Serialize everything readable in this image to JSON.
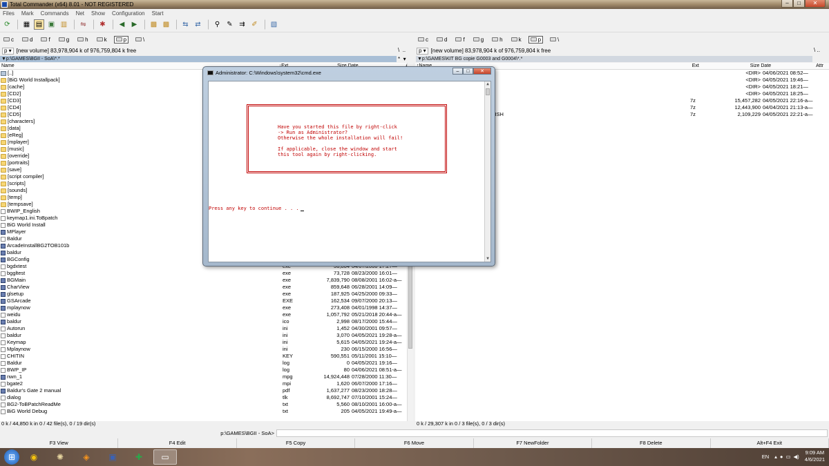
{
  "app": {
    "title": "Total Commander (x64) 8.01 - NOT REGISTERED"
  },
  "menu": [
    "Files",
    "Mark",
    "Commands",
    "Net",
    "Show",
    "Configuration",
    "Start"
  ],
  "drives": [
    "c",
    "d",
    "f",
    "g",
    "h",
    "k",
    "p",
    "\\"
  ],
  "left": {
    "volume": "[new volume]  83,978,904 k of 976,759,804 k free",
    "path": "▼p:\\GAMES\\BGII - SoA\\*.*",
    "headers": {
      "name": "Name",
      "ext": "↓Ext",
      "size": "Size",
      "date": "Date",
      "attr": "Attr"
    },
    "rows": [
      {
        "name": "[..]",
        "ext": "",
        "size": "",
        "date": "",
        "icon": "up"
      },
      {
        "name": "[BiG World Installpack]",
        "ext": "",
        "size": "",
        "date": "",
        "icon": "folder"
      },
      {
        "name": "[cache]",
        "ext": "",
        "size": "",
        "date": "",
        "icon": "folder"
      },
      {
        "name": "[CD2]",
        "ext": "",
        "size": "",
        "date": "",
        "icon": "folder"
      },
      {
        "name": "[CD3]",
        "ext": "",
        "size": "",
        "date": "",
        "icon": "folder"
      },
      {
        "name": "[CD4]",
        "ext": "",
        "size": "",
        "date": "",
        "icon": "folder"
      },
      {
        "name": "[CD5]",
        "ext": "",
        "size": "",
        "date": "",
        "icon": "folder"
      },
      {
        "name": "[characters]",
        "ext": "",
        "size": "",
        "date": "",
        "icon": "folder"
      },
      {
        "name": "[data]",
        "ext": "",
        "size": "",
        "date": "",
        "icon": "folder"
      },
      {
        "name": "[eReg]",
        "ext": "",
        "size": "",
        "date": "",
        "icon": "folder"
      },
      {
        "name": "[mplayer]",
        "ext": "",
        "size": "",
        "date": "",
        "icon": "folder"
      },
      {
        "name": "[music]",
        "ext": "",
        "size": "",
        "date": "",
        "icon": "folder"
      },
      {
        "name": "[override]",
        "ext": "",
        "size": "",
        "date": "",
        "icon": "folder"
      },
      {
        "name": "[portraits]",
        "ext": "",
        "size": "",
        "date": "",
        "icon": "folder"
      },
      {
        "name": "[save]",
        "ext": "",
        "size": "",
        "date": "",
        "icon": "folder"
      },
      {
        "name": "[script compiler]",
        "ext": "",
        "size": "",
        "date": "",
        "icon": "folder"
      },
      {
        "name": "[scripts]",
        "ext": "",
        "size": "",
        "date": "",
        "icon": "folder"
      },
      {
        "name": "[sounds]",
        "ext": "",
        "size": "",
        "date": "",
        "icon": "folder"
      },
      {
        "name": "[temp]",
        "ext": "",
        "size": "",
        "date": "",
        "icon": "folder"
      },
      {
        "name": "[tempsave]",
        "ext": "",
        "size": "",
        "date": "",
        "icon": "folder"
      },
      {
        "name": "BWIP_English",
        "ext": "",
        "size": "",
        "date": "",
        "icon": "file"
      },
      {
        "name": "keymap1.ini.ToBpatch",
        "ext": "",
        "size": "",
        "date": "",
        "icon": "file"
      },
      {
        "name": "BiG World Install",
        "ext": "",
        "size": "",
        "date": "",
        "icon": "file"
      },
      {
        "name": "MPlayer",
        "ext": "",
        "size": "",
        "date": "",
        "icon": "exe"
      },
      {
        "name": "Baldur",
        "ext": "",
        "size": "",
        "date": "",
        "icon": "file"
      },
      {
        "name": "ArcadeInstallBG2TOB101b",
        "ext": "",
        "size": "",
        "date": "",
        "icon": "exe"
      },
      {
        "name": "baldur",
        "ext": "",
        "size": "",
        "date": "",
        "icon": "exe"
      },
      {
        "name": "BGConfig",
        "ext": "",
        "size": "",
        "date": "",
        "icon": "exe"
      },
      {
        "name": "bgdxtest",
        "ext": "exe",
        "size": "36,864",
        "date": "04/07/2000 17:27—",
        "icon": "file"
      },
      {
        "name": "bggltest",
        "ext": "exe",
        "size": "73,728",
        "date": "08/23/2000 16:01—",
        "icon": "file"
      },
      {
        "name": "BGMain",
        "ext": "exe",
        "size": "7,839,790",
        "date": "08/08/2001 16:02-a—",
        "icon": "exe"
      },
      {
        "name": "CharView",
        "ext": "exe",
        "size": "859,648",
        "date": "06/28/2001 14:09—",
        "icon": "exe"
      },
      {
        "name": "glsetup",
        "ext": "exe",
        "size": "187,925",
        "date": "04/25/2000 09:33—",
        "icon": "exe"
      },
      {
        "name": "GSArcade",
        "ext": "EXE",
        "size": "162,534",
        "date": "09/07/2000 20:13—",
        "icon": "exe"
      },
      {
        "name": "mplaynow",
        "ext": "exe",
        "size": "273,408",
        "date": "04/01/1998 14:37—",
        "icon": "exe"
      },
      {
        "name": "weidu",
        "ext": "exe",
        "size": "1,057,792",
        "date": "05/21/2018 20:44-a—",
        "icon": "file"
      },
      {
        "name": "baldur",
        "ext": "ico",
        "size": "2,998",
        "date": "08/17/2000 15:44—",
        "icon": "exe"
      },
      {
        "name": "Autorun",
        "ext": "ini",
        "size": "1,452",
        "date": "04/30/2001 09:57—",
        "icon": "file"
      },
      {
        "name": "baldur",
        "ext": "ini",
        "size": "3,070",
        "date": "04/05/2021 19:28-a—",
        "icon": "file"
      },
      {
        "name": "Keymap",
        "ext": "ini",
        "size": "5,615",
        "date": "04/05/2021 19:24-a—",
        "icon": "file"
      },
      {
        "name": "Mplaynow",
        "ext": "ini",
        "size": "230",
        "date": "06/15/2000 16:56—",
        "icon": "file"
      },
      {
        "name": "CHITIN",
        "ext": "KEY",
        "size": "590,551",
        "date": "05/11/2001 15:10—",
        "icon": "file"
      },
      {
        "name": "Baldur",
        "ext": "log",
        "size": "0",
        "date": "04/05/2021 19:16—",
        "icon": "file"
      },
      {
        "name": "BWP_IP",
        "ext": "log",
        "size": "80",
        "date": "04/06/2021 08:51-a—",
        "icon": "file"
      },
      {
        "name": "nwn_1",
        "ext": "mpg",
        "size": "14,924,448",
        "date": "07/28/2000 11:30—",
        "icon": "exe"
      },
      {
        "name": "bgate2",
        "ext": "mpi",
        "size": "1,620",
        "date": "06/07/2000 17:16—",
        "icon": "file"
      },
      {
        "name": "Baldur's Gate 2 manual",
        "ext": "pdf",
        "size": "1,637,277",
        "date": "08/23/2000 18:28—",
        "icon": "exe"
      },
      {
        "name": "dialog",
        "ext": "tlk",
        "size": "8,692,747",
        "date": "07/10/2001 15:24—",
        "icon": "file"
      },
      {
        "name": "BG2-ToBPatchReadMe",
        "ext": "txt",
        "size": "5,560",
        "date": "08/10/2001 16:00-a—",
        "icon": "file"
      },
      {
        "name": "BiG World Debug",
        "ext": "txt",
        "size": "205",
        "date": "04/05/2021 19:49-a—",
        "icon": "file"
      }
    ],
    "status": "0 k / 44,850 k in 0 / 42 file(s), 0 / 19 dir(s)"
  },
  "right": {
    "volume": "[new volume]  83,978,904 k of 976,759,804 k free",
    "path": "▼p:\\GAMES\\KIT BG copie G0003 and G0004\\*.*",
    "headers": {
      "name": "↑Name",
      "ext": "Ext",
      "size": "Size",
      "date": "Date",
      "attr": "Attr"
    },
    "rows": [
      {
        "name": "",
        "ext": "",
        "size": "<DIR>",
        "date": "04/06/2021 08:52—"
      },
      {
        "name": "",
        "ext": "",
        "size": "<DIR>",
        "date": "04/05/2021 19:46—"
      },
      {
        "name": "",
        "ext": "",
        "size": "<DIR>",
        "date": "04/05/2021 18:21—"
      },
      {
        "name": "",
        "ext": "",
        "size": "<DIR>",
        "date": "04/05/2021 18:25—"
      },
      {
        "name": "",
        "ext": "7z",
        "size": "15,457,282",
        "date": "04/05/2021 22:16-a—"
      },
      {
        "name": "",
        "ext": "7z",
        "size": "12,443,900",
        "date": "04/04/2021 21:13-a—"
      },
      {
        "name": "NGLISH",
        "ext": "7z",
        "size": "2,109,229",
        "date": "04/05/2021 22:21-a—"
      }
    ],
    "status": "0 k / 29,307 k in 0 / 3 file(s), 0 / 3 dir(s)"
  },
  "cmdline": {
    "prompt": "p:\\GAMES\\BGII - SoA>"
  },
  "fkeys": [
    "F3 View",
    "F4 Edit",
    "F5 Copy",
    "F6 Move",
    "F7 NewFolder",
    "F8 Delete",
    "Alt+F4 Exit"
  ],
  "console": {
    "title": "Administrator: C:\\Windows\\system32\\cmd.exe",
    "message": "Have you started this file by right-click\n-> Run as Administrator?\nOtherwise the whole installation will fail!\n\nIf applicable, close the window and start\nthis tool again by right-clicking.",
    "prompt": "Press any key to continue . . ."
  },
  "tray": {
    "lang": "EN",
    "time": "9:09 AM",
    "date": "4/6/2021"
  }
}
